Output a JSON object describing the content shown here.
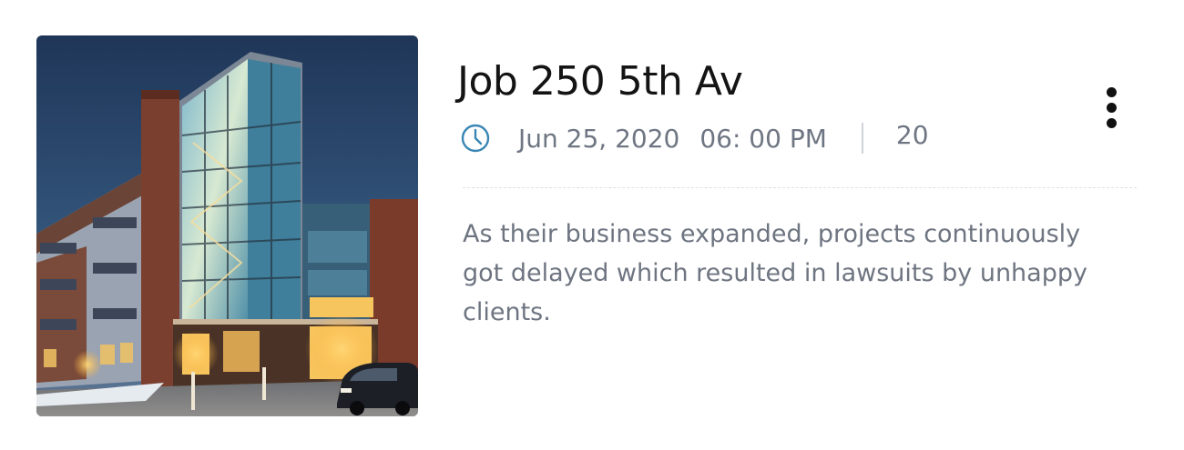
{
  "job": {
    "title": "Job 250 5th Av",
    "date": "Jun 25, 2020",
    "time": "06: 00 PM",
    "count": "20",
    "description": "As their business expanded, projects continuously got delayed which resulted in lawsuits by unhappy clients."
  },
  "icons": {
    "clock": "clock-icon",
    "more": "more-vertical-icon"
  },
  "colors": {
    "title": "#141414",
    "meta_text": "#6f7683",
    "clock_accent": "#3a86b4",
    "description": "#6e7581"
  }
}
